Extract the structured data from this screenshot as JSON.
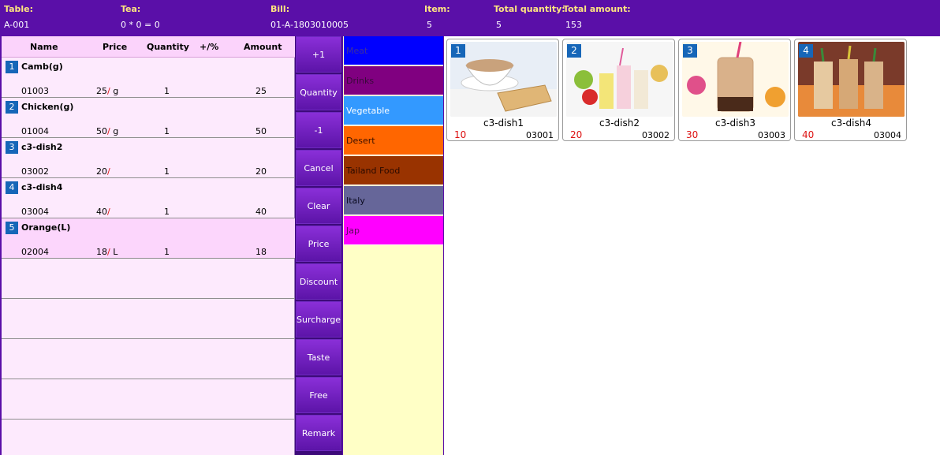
{
  "header": {
    "table_label": "Table:",
    "table_value": "A-001",
    "tea_label": "Tea:",
    "tea_value": "0 * 0 = 0",
    "bill_label": "Bill:",
    "bill_value": "01-A-1803010005",
    "item_label": "Item:",
    "item_value": "5",
    "tq_label": "Total quantity:",
    "tq_value": "5",
    "ta_label": "Total amount:",
    "ta_value": "153"
  },
  "order": {
    "columns": {
      "name": "Name",
      "price": "Price",
      "quantity": "Quantity",
      "adjust": "+/%",
      "amount": "Amount"
    },
    "rows": [
      {
        "index": "1",
        "name": "Camb(g)",
        "code": "01003",
        "price": "25",
        "unit": "g",
        "quantity": "1",
        "amount": "25"
      },
      {
        "index": "2",
        "name": "Chicken(g)",
        "code": "01004",
        "price": "50",
        "unit": "g",
        "quantity": "1",
        "amount": "50"
      },
      {
        "index": "3",
        "name": "c3-dish2",
        "code": "03002",
        "price": "20",
        "unit": "",
        "quantity": "1",
        "amount": "20"
      },
      {
        "index": "4",
        "name": "c3-dish4",
        "code": "03004",
        "price": "40",
        "unit": "",
        "quantity": "1",
        "amount": "40"
      },
      {
        "index": "5",
        "name": "Orange(L)",
        "code": "02004",
        "price": "18",
        "unit": "L",
        "quantity": "1",
        "amount": "18"
      }
    ]
  },
  "actions": [
    "+1",
    "Quantity",
    "-1",
    "Cancel",
    "Clear",
    "Price",
    "Discount",
    "Surcharge",
    "Taste",
    "Free",
    "Remark"
  ],
  "categories": [
    {
      "label": "Meat",
      "color": "#0000ff"
    },
    {
      "label": "Drinks",
      "color": "#800080"
    },
    {
      "label": "Vegetable",
      "color": "#3399ff"
    },
    {
      "label": "Desert",
      "color": "#ff6600"
    },
    {
      "label": "Tailand Food",
      "color": "#993300"
    },
    {
      "label": "Italy",
      "color": "#666699"
    },
    {
      "label": "Jap",
      "color": "#ff00ff"
    }
  ],
  "dishes": [
    {
      "index": "1",
      "name": "c3-dish1",
      "price": "10",
      "code": "03001",
      "image": "milk-tea-toast"
    },
    {
      "index": "2",
      "name": "c3-dish2",
      "price": "20",
      "code": "03002",
      "image": "fruit-smoothies"
    },
    {
      "index": "3",
      "name": "c3-dish3",
      "price": "30",
      "code": "03003",
      "image": "bubble-tea-mug"
    },
    {
      "index": "4",
      "name": "c3-dish4",
      "price": "40",
      "code": "03004",
      "image": "iced-milk-teas"
    }
  ]
}
